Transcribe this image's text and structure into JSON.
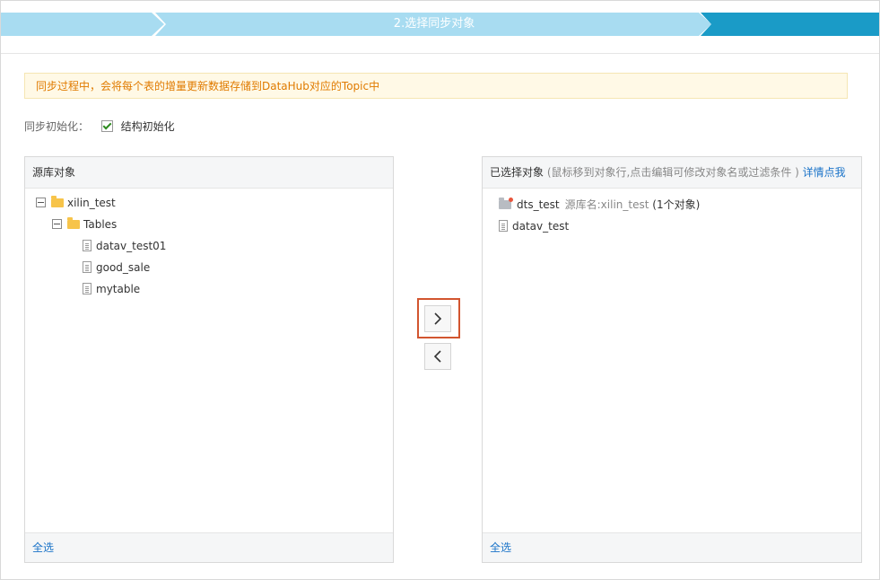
{
  "steps": {
    "step1": "",
    "step2": "2.选择同步对象",
    "step3": ""
  },
  "notice": "同步过程中，会将每个表的增量更新数据存储到DataHub对应的Topic中",
  "init": {
    "label": "同步初始化：",
    "option": "结构初始化",
    "checked": true
  },
  "left_panel": {
    "title": "源库对象",
    "tree": {
      "root": "xilin_test",
      "group": "Tables",
      "tables": [
        "datav_test01",
        "good_sale",
        "mytable"
      ]
    },
    "footer": "全选"
  },
  "right_panel": {
    "title": "已选择对象",
    "hint": "(鼠标移到对象行,点击编辑可修改对象名或过滤条件 )",
    "link": "详情点我",
    "db_name": "dts_test",
    "source_label": "源库名:xilin_test",
    "count_label": "(1个对象)",
    "tables": [
      "datav_test"
    ],
    "footer": "全选"
  },
  "colors": {
    "step_light": "#a8dcf1",
    "step_active": "#1a9bc7",
    "notice_text": "#e07b00",
    "link": "#1a73c8",
    "highlight": "#d2552f"
  }
}
